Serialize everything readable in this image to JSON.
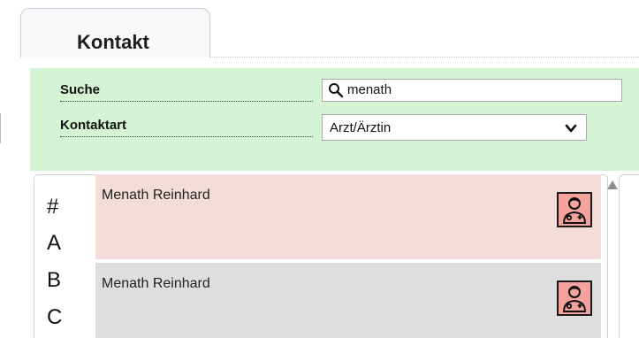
{
  "tab": {
    "label": "Kontakt"
  },
  "search": {
    "label_prefix_bold": "Suche",
    "query": "menath",
    "icon": "search-icon"
  },
  "filter": {
    "label": "Kontaktart",
    "selected": "Arzt/Ärztin",
    "icon": "chevron-down-icon"
  },
  "alphabet_index": [
    "#",
    "A",
    "B",
    "C"
  ],
  "contacts": [
    {
      "name": "Menath Reinhard",
      "icon": "doctor-icon",
      "row_color": "#f4ddd9"
    },
    {
      "name": "Menath Reinhard",
      "icon": "doctor-icon",
      "row_color": "#dedede"
    }
  ],
  "colors": {
    "panel_bg": "#d4f4d4",
    "badge_bg": "#f4a29c",
    "tab_bg": "#f7f9fb"
  }
}
